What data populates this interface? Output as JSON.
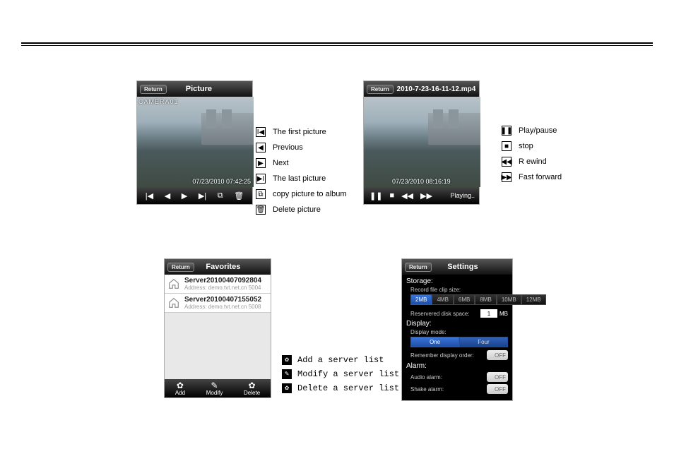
{
  "picture_panel": {
    "return_label": "Return",
    "title": "Picture",
    "cam_label": "CAMERA01",
    "timestamp": "07/23/2010  07:42:25"
  },
  "picture_legend": [
    {
      "label": "The first picture"
    },
    {
      "label": "Previous"
    },
    {
      "label": "Next"
    },
    {
      "label": "The last picture"
    },
    {
      "label": "copy picture to album"
    },
    {
      "label": "Delete picture"
    }
  ],
  "video_panel": {
    "return_label": "Return",
    "title": "2010-7-23-16-11-12.mp4",
    "timestamp": "07/23/2010  08:16:19",
    "status": "Playing.."
  },
  "video_legend": [
    {
      "label": "Play/pause"
    },
    {
      "label": "stop"
    },
    {
      "label": "R ewind"
    },
    {
      "label": "Fast forward"
    }
  ],
  "favorites_panel": {
    "return_label": "Return",
    "title": "Favorites",
    "items": [
      {
        "name": "Server20100407092804",
        "addr": "Address: demo.tvt.net.cn 5004"
      },
      {
        "name": "Server20100407155052",
        "addr": "Address: demo.tvt.net.cn 5008"
      }
    ],
    "footer": {
      "add": "Add",
      "modify": "Modify",
      "delete": "Delete"
    }
  },
  "favorites_legend": [
    {
      "label": "Add a server list"
    },
    {
      "label": "Modify a server list"
    },
    {
      "label": "Delete a server list"
    }
  ],
  "settings_panel": {
    "return_label": "Return",
    "title": "Settings",
    "storage_hdr": "Storage:",
    "clip_label": "Record file clip size:",
    "clip_options": [
      "2MB",
      "4MB",
      "6MB",
      "8MB",
      "10MB",
      "12MB"
    ],
    "reserved_label": "Reservered disk space:",
    "reserved_value": "1",
    "reserved_unit": "MB",
    "display_hdr": "Display:",
    "displaymode_label": "Display mode:",
    "displaymode_options": [
      "One",
      "Four"
    ],
    "remember_label": "Remember display order:",
    "alarm_hdr": "Alarm:",
    "audio_label": "Audio alarm:",
    "shake_label": "Shake alarm:",
    "off_label": "OFF"
  }
}
